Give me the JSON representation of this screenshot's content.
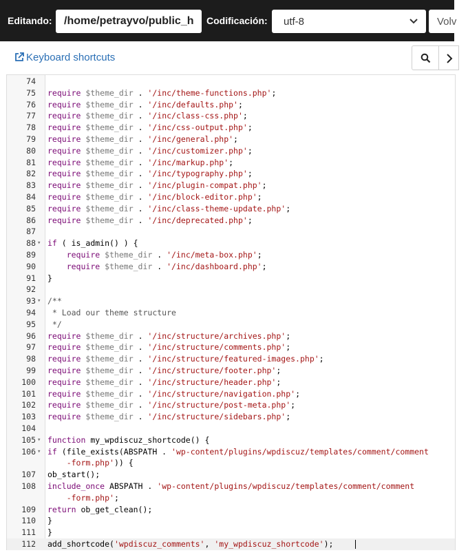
{
  "toolbar": {
    "editing_label": "Editando:",
    "path_value": "/home/petrayvo/public_h",
    "encoding_label": "Codificación:",
    "encoding_value": "utf-8",
    "back_label": "Volv"
  },
  "shortcuts_link": "Keyboard shortcuts",
  "icons": {
    "shortcuts": "external-link-icon",
    "search": "search-icon",
    "next": "chevron-right-icon",
    "select": "chevron-down-icon"
  },
  "colors": {
    "topbar": "#1c1c1c",
    "link": "#2a6fb5",
    "keyword": "#7a0874",
    "string": "#a31515",
    "variable": "#777777"
  },
  "editor": {
    "active_line": "112",
    "lines": [
      {
        "n": "74",
        "fold": false,
        "parts": []
      },
      {
        "n": "75",
        "fold": false,
        "parts": [
          [
            "kw",
            "require "
          ],
          [
            "var",
            "$theme_dir"
          ],
          [
            "op",
            " . "
          ],
          [
            "str",
            "'/inc/theme-functions.php'"
          ],
          [
            "op",
            ";"
          ]
        ]
      },
      {
        "n": "76",
        "fold": false,
        "parts": [
          [
            "kw",
            "require "
          ],
          [
            "var",
            "$theme_dir"
          ],
          [
            "op",
            " . "
          ],
          [
            "str",
            "'/inc/defaults.php'"
          ],
          [
            "op",
            ";"
          ]
        ]
      },
      {
        "n": "77",
        "fold": false,
        "parts": [
          [
            "kw",
            "require "
          ],
          [
            "var",
            "$theme_dir"
          ],
          [
            "op",
            " . "
          ],
          [
            "str",
            "'/inc/class-css.php'"
          ],
          [
            "op",
            ";"
          ]
        ]
      },
      {
        "n": "78",
        "fold": false,
        "parts": [
          [
            "kw",
            "require "
          ],
          [
            "var",
            "$theme_dir"
          ],
          [
            "op",
            " . "
          ],
          [
            "str",
            "'/inc/css-output.php'"
          ],
          [
            "op",
            ";"
          ]
        ]
      },
      {
        "n": "79",
        "fold": false,
        "parts": [
          [
            "kw",
            "require "
          ],
          [
            "var",
            "$theme_dir"
          ],
          [
            "op",
            " . "
          ],
          [
            "str",
            "'/inc/general.php'"
          ],
          [
            "op",
            ";"
          ]
        ]
      },
      {
        "n": "80",
        "fold": false,
        "parts": [
          [
            "kw",
            "require "
          ],
          [
            "var",
            "$theme_dir"
          ],
          [
            "op",
            " . "
          ],
          [
            "str",
            "'/inc/customizer.php'"
          ],
          [
            "op",
            ";"
          ]
        ]
      },
      {
        "n": "81",
        "fold": false,
        "parts": [
          [
            "kw",
            "require "
          ],
          [
            "var",
            "$theme_dir"
          ],
          [
            "op",
            " . "
          ],
          [
            "str",
            "'/inc/markup.php'"
          ],
          [
            "op",
            ";"
          ]
        ]
      },
      {
        "n": "82",
        "fold": false,
        "parts": [
          [
            "kw",
            "require "
          ],
          [
            "var",
            "$theme_dir"
          ],
          [
            "op",
            " . "
          ],
          [
            "str",
            "'/inc/typography.php'"
          ],
          [
            "op",
            ";"
          ]
        ]
      },
      {
        "n": "83",
        "fold": false,
        "parts": [
          [
            "kw",
            "require "
          ],
          [
            "var",
            "$theme_dir"
          ],
          [
            "op",
            " . "
          ],
          [
            "str",
            "'/inc/plugin-compat.php'"
          ],
          [
            "op",
            ";"
          ]
        ]
      },
      {
        "n": "84",
        "fold": false,
        "parts": [
          [
            "kw",
            "require "
          ],
          [
            "var",
            "$theme_dir"
          ],
          [
            "op",
            " . "
          ],
          [
            "str",
            "'/inc/block-editor.php'"
          ],
          [
            "op",
            ";"
          ]
        ]
      },
      {
        "n": "85",
        "fold": false,
        "parts": [
          [
            "kw",
            "require "
          ],
          [
            "var",
            "$theme_dir"
          ],
          [
            "op",
            " . "
          ],
          [
            "str",
            "'/inc/class-theme-update.php'"
          ],
          [
            "op",
            ";"
          ]
        ]
      },
      {
        "n": "86",
        "fold": false,
        "parts": [
          [
            "kw",
            "require "
          ],
          [
            "var",
            "$theme_dir"
          ],
          [
            "op",
            " . "
          ],
          [
            "str",
            "'/inc/deprecated.php'"
          ],
          [
            "op",
            ";"
          ]
        ]
      },
      {
        "n": "87",
        "fold": false,
        "parts": []
      },
      {
        "n": "88",
        "fold": true,
        "parts": [
          [
            "kw",
            "if"
          ],
          [
            "op",
            " ( is_admin() ) {"
          ]
        ]
      },
      {
        "n": "89",
        "fold": false,
        "parts": [
          [
            "op",
            "    "
          ],
          [
            "kw",
            "require "
          ],
          [
            "var",
            "$theme_dir"
          ],
          [
            "op",
            " . "
          ],
          [
            "str",
            "'/inc/meta-box.php'"
          ],
          [
            "op",
            ";"
          ]
        ]
      },
      {
        "n": "90",
        "fold": false,
        "parts": [
          [
            "op",
            "    "
          ],
          [
            "kw",
            "require "
          ],
          [
            "var",
            "$theme_dir"
          ],
          [
            "op",
            " . "
          ],
          [
            "str",
            "'/inc/dashboard.php'"
          ],
          [
            "op",
            ";"
          ]
        ]
      },
      {
        "n": "91",
        "fold": false,
        "parts": [
          [
            "op",
            "}"
          ]
        ]
      },
      {
        "n": "92",
        "fold": false,
        "parts": []
      },
      {
        "n": "93",
        "fold": true,
        "parts": [
          [
            "cm",
            "/**"
          ]
        ]
      },
      {
        "n": "94",
        "fold": false,
        "parts": [
          [
            "cm",
            " * Load our theme structure"
          ]
        ]
      },
      {
        "n": "95",
        "fold": false,
        "parts": [
          [
            "cm",
            " */"
          ]
        ]
      },
      {
        "n": "96",
        "fold": false,
        "parts": [
          [
            "kw",
            "require "
          ],
          [
            "var",
            "$theme_dir"
          ],
          [
            "op",
            " . "
          ],
          [
            "str",
            "'/inc/structure/archives.php'"
          ],
          [
            "op",
            ";"
          ]
        ]
      },
      {
        "n": "97",
        "fold": false,
        "parts": [
          [
            "kw",
            "require "
          ],
          [
            "var",
            "$theme_dir"
          ],
          [
            "op",
            " . "
          ],
          [
            "str",
            "'/inc/structure/comments.php'"
          ],
          [
            "op",
            ";"
          ]
        ]
      },
      {
        "n": "98",
        "fold": false,
        "parts": [
          [
            "kw",
            "require "
          ],
          [
            "var",
            "$theme_dir"
          ],
          [
            "op",
            " . "
          ],
          [
            "str",
            "'/inc/structure/featured-images.php'"
          ],
          [
            "op",
            ";"
          ]
        ]
      },
      {
        "n": "99",
        "fold": false,
        "parts": [
          [
            "kw",
            "require "
          ],
          [
            "var",
            "$theme_dir"
          ],
          [
            "op",
            " . "
          ],
          [
            "str",
            "'/inc/structure/footer.php'"
          ],
          [
            "op",
            ";"
          ]
        ]
      },
      {
        "n": "100",
        "fold": false,
        "parts": [
          [
            "kw",
            "require "
          ],
          [
            "var",
            "$theme_dir"
          ],
          [
            "op",
            " . "
          ],
          [
            "str",
            "'/inc/structure/header.php'"
          ],
          [
            "op",
            ";"
          ]
        ]
      },
      {
        "n": "101",
        "fold": false,
        "parts": [
          [
            "kw",
            "require "
          ],
          [
            "var",
            "$theme_dir"
          ],
          [
            "op",
            " . "
          ],
          [
            "str",
            "'/inc/structure/navigation.php'"
          ],
          [
            "op",
            ";"
          ]
        ]
      },
      {
        "n": "102",
        "fold": false,
        "parts": [
          [
            "kw",
            "require "
          ],
          [
            "var",
            "$theme_dir"
          ],
          [
            "op",
            " . "
          ],
          [
            "str",
            "'/inc/structure/post-meta.php'"
          ],
          [
            "op",
            ";"
          ]
        ]
      },
      {
        "n": "103",
        "fold": false,
        "parts": [
          [
            "kw",
            "require "
          ],
          [
            "var",
            "$theme_dir"
          ],
          [
            "op",
            " . "
          ],
          [
            "str",
            "'/inc/structure/sidebars.php'"
          ],
          [
            "op",
            ";"
          ]
        ]
      },
      {
        "n": "104",
        "fold": false,
        "parts": []
      },
      {
        "n": "105",
        "fold": true,
        "parts": [
          [
            "kw",
            "function"
          ],
          [
            "op",
            " my_wpdiscuz_shortcode() {"
          ]
        ]
      },
      {
        "n": "106",
        "fold": true,
        "parts": [
          [
            "kw",
            "if"
          ],
          [
            "op",
            " (file_exists(ABSPATH . "
          ],
          [
            "str",
            "'wp-content/plugins/wpdiscuz/templates/comment/comment"
          ]
        ]
      },
      {
        "n": "",
        "fold": false,
        "parts": [
          [
            "str",
            "    -form.php'"
          ],
          [
            "op",
            ")) {"
          ]
        ]
      },
      {
        "n": "107",
        "fold": false,
        "parts": [
          [
            "op",
            "ob_start();"
          ]
        ]
      },
      {
        "n": "108",
        "fold": false,
        "parts": [
          [
            "kw",
            "include_once"
          ],
          [
            "op",
            " ABSPATH . "
          ],
          [
            "str",
            "'wp-content/plugins/wpdiscuz/templates/comment/comment"
          ]
        ]
      },
      {
        "n": "",
        "fold": false,
        "parts": [
          [
            "str",
            "    -form.php'"
          ],
          [
            "op",
            ";"
          ]
        ]
      },
      {
        "n": "109",
        "fold": false,
        "parts": [
          [
            "kw",
            "return"
          ],
          [
            "op",
            " ob_get_clean();"
          ]
        ]
      },
      {
        "n": "110",
        "fold": false,
        "parts": [
          [
            "op",
            "}"
          ]
        ]
      },
      {
        "n": "111",
        "fold": false,
        "parts": [
          [
            "op",
            "}"
          ]
        ]
      },
      {
        "n": "112",
        "fold": false,
        "parts": [
          [
            "op",
            "add_shortcode("
          ],
          [
            "str",
            "'wpdiscuz_comments'"
          ],
          [
            "op",
            ", "
          ],
          [
            "str",
            "'my_wpdiscuz_shortcode'"
          ],
          [
            "op",
            ");"
          ]
        ]
      }
    ]
  }
}
